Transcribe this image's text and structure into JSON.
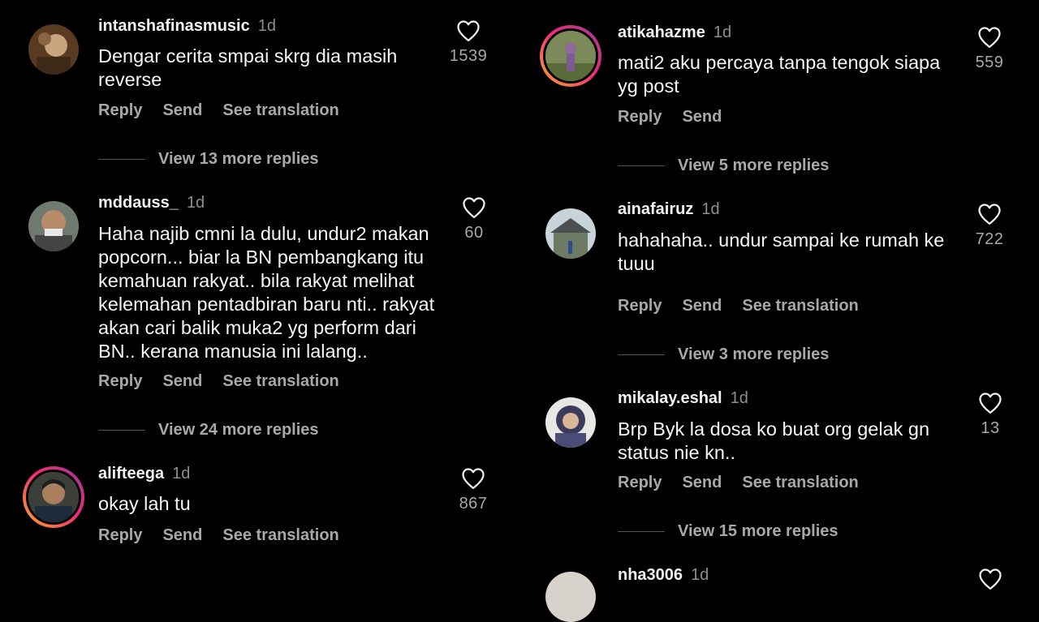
{
  "left": [
    {
      "username": "intanshafinasmusic",
      "time": "1d",
      "text": "Dengar cerita smpai skrg dia masih\nreverse",
      "likes": "1539",
      "actions": [
        "Reply",
        "Send",
        "See translation"
      ],
      "view_replies": "View 13 more replies"
    },
    {
      "username": "mddauss_",
      "time": "1d",
      "text": "Haha najib cmni la dulu, undur2 makan\npopcorn... biar la BN pembangkang itu\nkemahuan rakyat.. bila rakyat melihat\nkelemahan pentadbiran baru nti.. rakyat\nakan cari balik muka2 yg perform dari\nBN.. kerana manusia ini lalang..",
      "likes": "60",
      "actions": [
        "Reply",
        "Send",
        "See translation"
      ],
      "view_replies": "View 24 more replies"
    },
    {
      "username": "alifteega",
      "time": "1d",
      "text": "okay lah tu",
      "likes": "867",
      "actions": [
        "Reply",
        "Send",
        "See translation"
      ]
    }
  ],
  "right": [
    {
      "username": "atikahazme",
      "time": "1d",
      "text": "mati2 aku percaya tanpa tengok siapa\nyg post",
      "likes": "559",
      "actions": [
        "Reply",
        "Send"
      ],
      "view_replies": "View 5 more replies"
    },
    {
      "username": "ainafairuz",
      "time": "1d",
      "text": "hahahaha.. undur sampai ke rumah ke\ntuuu",
      "likes": "722",
      "actions": [
        "Reply",
        "Send",
        "See translation"
      ],
      "view_replies": "View 3 more replies"
    },
    {
      "username": "mikalay.eshal",
      "time": "1d",
      "text": "Brp Byk la dosa ko buat org gelak gn\nstatus nie kn..",
      "likes": "13",
      "actions": [
        "Reply",
        "Send",
        "See translation"
      ],
      "view_replies": "View 15 more replies"
    },
    {
      "username": "nha3006",
      "time": "1d"
    }
  ],
  "icons": {
    "like": "heart-outline-icon"
  },
  "colors": {
    "background": "#000000",
    "primary_text": "#f5f5f5",
    "secondary_text": "#a8a8a8",
    "story_ring_start": "#f9a826",
    "story_ring_end": "#8a2be2"
  }
}
